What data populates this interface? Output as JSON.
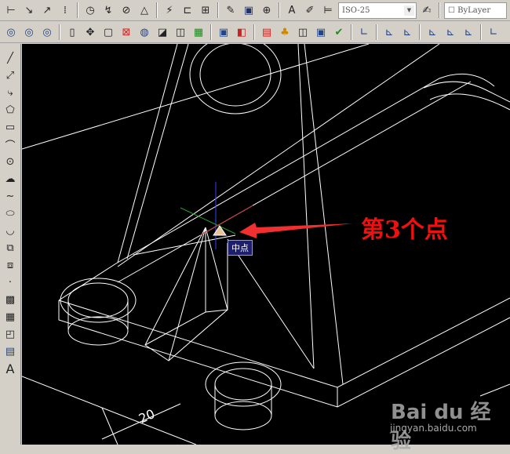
{
  "toolbar1": {
    "icons": [
      "linear-dim",
      "aligned-dim",
      "arc-length-dim",
      "ordinate-dim",
      "radius-dim",
      "jogged-dim",
      "diameter-dim",
      "angular-dim",
      "quick-dim",
      "baseline-dim",
      "continue-dim",
      "quick-leader",
      "tolerance",
      "center-mark",
      "dim-edit",
      "dim-text-edit",
      "dim-update"
    ],
    "dimstyle": "ISO-25",
    "layer": "ByLayer"
  },
  "toolbar2": {
    "icons": [
      "union",
      "subtract",
      "intersect",
      "extrude",
      "move-3d",
      "box",
      "interfere",
      "revolve",
      "slice",
      "section",
      "setup",
      "solid-edit",
      "imprint",
      "clean",
      "separate",
      "shell",
      "check",
      "ucs",
      "ucs-world",
      "ucs-previous",
      "ucs-face",
      "ucs-object",
      "ucs-view",
      "ucs-origin"
    ]
  },
  "left_toolbar": {
    "icons": [
      "line",
      "construction-line",
      "polyline",
      "polygon",
      "rectangle",
      "arc",
      "circle",
      "revision-cloud",
      "spline",
      "ellipse",
      "ellipse-arc",
      "insert-block",
      "make-block",
      "point",
      "hatch",
      "gradient",
      "region",
      "table",
      "multiline-text"
    ]
  },
  "canvas": {
    "osnap_tooltip": "中点",
    "annotation": "第3个点",
    "dimension_text": "20",
    "annotation_color": "#f01010"
  },
  "watermark": {
    "brand": "Bai du 经验",
    "url": "jingyan.baidu.com"
  }
}
